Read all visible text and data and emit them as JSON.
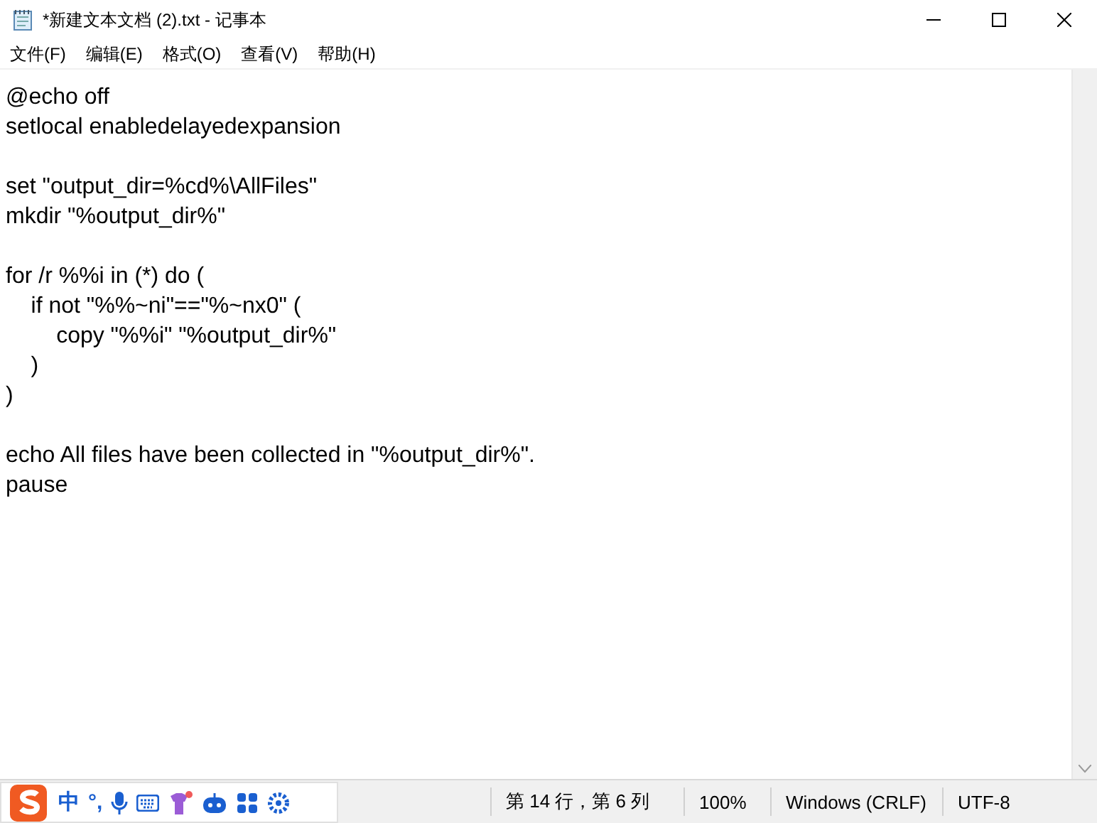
{
  "window": {
    "title": "*新建文本文档 (2).txt - 记事本"
  },
  "menu": [
    "文件(F)",
    "编辑(E)",
    "格式(O)",
    "查看(V)",
    "帮助(H)"
  ],
  "editor": {
    "text": "@echo off\nsetlocal enabledelayedexpansion\n\nset \"output_dir=%cd%\\AllFiles\"\nmkdir \"%output_dir%\"\n\nfor /r %%i in (*) do (\n    if not \"%%~ni\"==\"%~nx0\" (\n        copy \"%%i\" \"%output_dir%\"\n    )\n)\n\necho All files have been collected in \"%output_dir%\".\npause"
  },
  "status_bar": [
    "第 14 行，第 6 列",
    "100%",
    "Windows (CRLF)",
    "UTF-8"
  ],
  "ime_toolbar": {
    "mode": "中",
    "punctuation": "°,"
  }
}
